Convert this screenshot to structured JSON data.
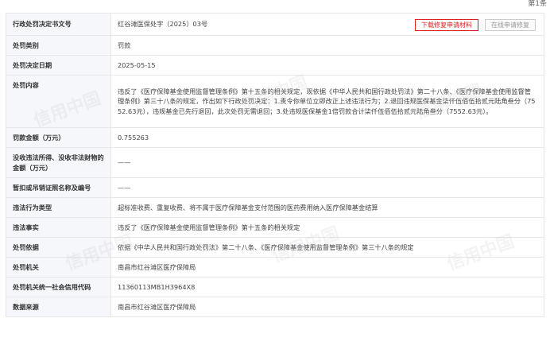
{
  "pagination": {
    "counter": "第1条"
  },
  "record": {
    "doc_number_label": "行政处罚决定书文号",
    "doc_number_value": "红谷滩医保处字（2025）03号",
    "buttons": {
      "download": "下载修复申请材料",
      "online_repair": "在线申请修复"
    },
    "rows": [
      {
        "key": "penalty_type",
        "label": "处罚类别",
        "value": "罚款"
      },
      {
        "key": "decision_date",
        "label": "处罚决定日期",
        "value": "2025-05-15"
      },
      {
        "key": "penalty_content",
        "label": "处罚内容",
        "value": "违反了《医疗保障基金使用监督管理条例》第十五条的相关规定，现依据《中华人民共和国行政处罚法》第二十八条、《医疗保障基金使用监督管理条例》第三十八条的规定，作出如下行政处罚决定：1.责令你单位立即改正上述违法行为；2.退回违规医保基金柒仟伍佰伍拾贰元陆角叁分（7552.63元），违规基金已先行退回，此次处罚无需退回；3.处违规医保基金1倍罚款合计柒仟伍佰伍拾贰元陆角叁分（7552.63元）。"
      },
      {
        "key": "fine_amount",
        "label": "罚款金额（万元）",
        "value": "0.755263"
      },
      {
        "key": "confiscation_amount",
        "label": "没收违法所得、没收非法财物的金额（万元）",
        "value": "——"
      },
      {
        "key": "license_suspension",
        "label": "暂扣或吊销证照名称及编号",
        "value": "——"
      },
      {
        "key": "violation_type",
        "label": "违法行为类型",
        "value": "超标准收费、重复收费、将不属于医疗保障基金支付范围的医药费用纳入医疗保障基金结算"
      },
      {
        "key": "violation_facts",
        "label": "违法事实",
        "value": "违反了《医疗保障基金使用监督管理条例》第十五条的相关规定"
      },
      {
        "key": "penalty_basis",
        "label": "处罚依据",
        "value": "依据《中华人民共和国行政处罚法》第二十八条、《医疗保障基金使用监督管理条例》第三十八条的规定"
      },
      {
        "key": "penalty_authority",
        "label": "处罚机关",
        "value": "南昌市红谷滩区医疗保障局"
      },
      {
        "key": "credit_code",
        "label": "处罚机关统一社会信用代码",
        "value": "11360113MB1H3964X8"
      },
      {
        "key": "data_source",
        "label": "数据来源",
        "value": "南昌市红谷滩区医疗保障局"
      }
    ]
  },
  "watermark_text": "信用中国"
}
